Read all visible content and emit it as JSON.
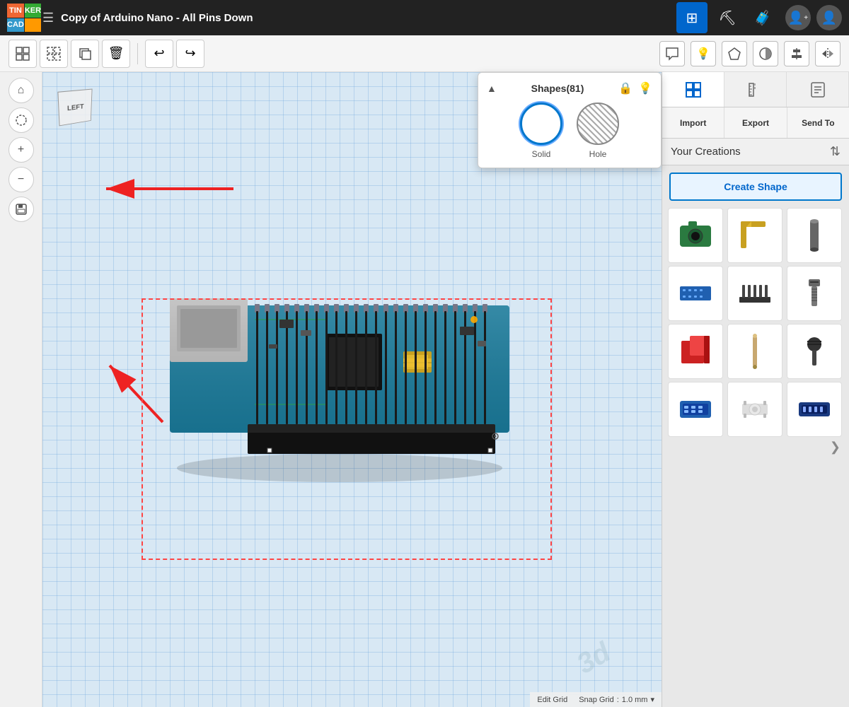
{
  "topbar": {
    "logo": {
      "cells": [
        "TIN",
        "KER",
        "CAD",
        ""
      ]
    },
    "project_title": "Copy of Arduino Nano - All Pins Down",
    "nav_icons": [
      {
        "name": "grid-view",
        "symbol": "⊞",
        "active": true
      },
      {
        "name": "pickaxe",
        "symbol": "⛏",
        "active": false
      },
      {
        "name": "suitcase",
        "symbol": "🧳",
        "active": false
      }
    ]
  },
  "toolbar": {
    "tools": [
      {
        "name": "group",
        "symbol": "⬡",
        "label": "Group"
      },
      {
        "name": "ungroup",
        "symbol": "⬡",
        "label": "Ungroup"
      },
      {
        "name": "duplicate",
        "symbol": "⧉",
        "label": "Duplicate"
      },
      {
        "name": "delete",
        "symbol": "🗑",
        "label": "Delete"
      },
      {
        "name": "undo",
        "symbol": "↩",
        "label": "Undo"
      },
      {
        "name": "redo",
        "symbol": "↪",
        "label": "Redo"
      }
    ],
    "right_tools": [
      {
        "name": "annotate",
        "symbol": "💬"
      },
      {
        "name": "bulb",
        "symbol": "💡"
      },
      {
        "name": "pentagon",
        "symbol": "⬠"
      },
      {
        "name": "circle-half",
        "symbol": "◑"
      },
      {
        "name": "align",
        "symbol": "⊞"
      },
      {
        "name": "mirror",
        "symbol": "⇔"
      }
    ]
  },
  "left_panel": {
    "tools": [
      {
        "name": "home",
        "symbol": "⌂"
      },
      {
        "name": "frame",
        "symbol": "⊡"
      },
      {
        "name": "zoom-in",
        "symbol": "+"
      },
      {
        "name": "zoom-out",
        "symbol": "−"
      },
      {
        "name": "save",
        "symbol": "💾"
      }
    ]
  },
  "shapes_popup": {
    "title": "Shapes(81)",
    "solid_label": "Solid",
    "hole_label": "Hole"
  },
  "right_panel": {
    "tabs": [
      {
        "name": "grid-tab",
        "symbol": "⊞"
      },
      {
        "name": "ruler-tab",
        "symbol": "📐"
      },
      {
        "name": "notes-tab",
        "symbol": "📋"
      }
    ],
    "actions": [
      "Import",
      "Export",
      "Send To"
    ],
    "your_creations": "Your Creations",
    "create_shape": "Create Shape",
    "shapes": [
      {
        "id": "s1",
        "color": "#2a7a40",
        "type": "camera"
      },
      {
        "id": "s2",
        "color": "#c8a020",
        "type": "bracket"
      },
      {
        "id": "s3",
        "color": "#555555",
        "type": "cylinder"
      },
      {
        "id": "s4",
        "color": "#2060b0",
        "type": "chip"
      },
      {
        "id": "s5",
        "color": "#333333",
        "type": "comb"
      },
      {
        "id": "s6",
        "color": "#555555",
        "type": "screw"
      },
      {
        "id": "s7",
        "color": "#cc2222",
        "type": "cube"
      },
      {
        "id": "s8",
        "color": "#c8a870",
        "type": "rod"
      },
      {
        "id": "s9",
        "color": "#333333",
        "type": "bolt"
      },
      {
        "id": "s10",
        "color": "#2060b0",
        "type": "chip2"
      },
      {
        "id": "s11",
        "color": "#cccccc",
        "type": "button"
      },
      {
        "id": "s12",
        "color": "#1a3a80",
        "type": "connector"
      }
    ]
  },
  "status_bar": {
    "edit_grid": "Edit Grid",
    "snap_grid": "Snap Grid",
    "snap_value": "1.0 mm",
    "dropdown": "▾"
  },
  "view_cube": {
    "label": "LEFT"
  }
}
